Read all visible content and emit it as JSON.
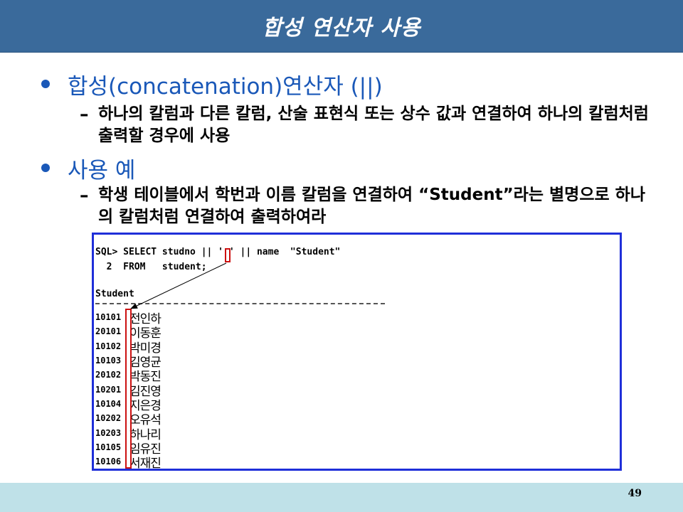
{
  "slide": {
    "title": "합성 연산자 사용",
    "page_number": "49"
  },
  "bullets": [
    {
      "text": "합성(concatenation)연산자 (||)",
      "sub": "하나의 칼럼과 다른 칼럼, 산술 표현식 또는 상수 값과 연결하여 하나의 칼럼처럼 출력할 경우에 사용"
    },
    {
      "text": "사용 예",
      "sub": "학생 테이블에서 학번과 이름 칼럼을 연결하여 “Student”라는 별명으로 하나의 칼럼처럼 연결하여 출력하여라"
    }
  ],
  "sql": {
    "line1": "SQL> SELECT studno || ' ' || name  \"Student\"",
    "line2": "  2  FROM   student;",
    "column_header": "Student",
    "rows": [
      {
        "studno": "10101",
        "name": "전인하"
      },
      {
        "studno": "20101",
        "name": "이동훈"
      },
      {
        "studno": "10102",
        "name": "박미경"
      },
      {
        "studno": "10103",
        "name": "김영균"
      },
      {
        "studno": "20102",
        "name": "박동진"
      },
      {
        "studno": "10201",
        "name": "김진영"
      },
      {
        "studno": "10104",
        "name": "지은경"
      },
      {
        "studno": "10202",
        "name": "오유석"
      },
      {
        "studno": "10203",
        "name": "하나리"
      },
      {
        "studno": "10105",
        "name": "임유진"
      },
      {
        "studno": "10106",
        "name": "서재진"
      }
    ]
  },
  "colors": {
    "title_bar": "#3a6a9b",
    "bullet_blue": "#1a58b8",
    "code_border": "#1f2fd9",
    "highlight_red": "#cc1111",
    "footer_band": "#bfe1e8"
  }
}
